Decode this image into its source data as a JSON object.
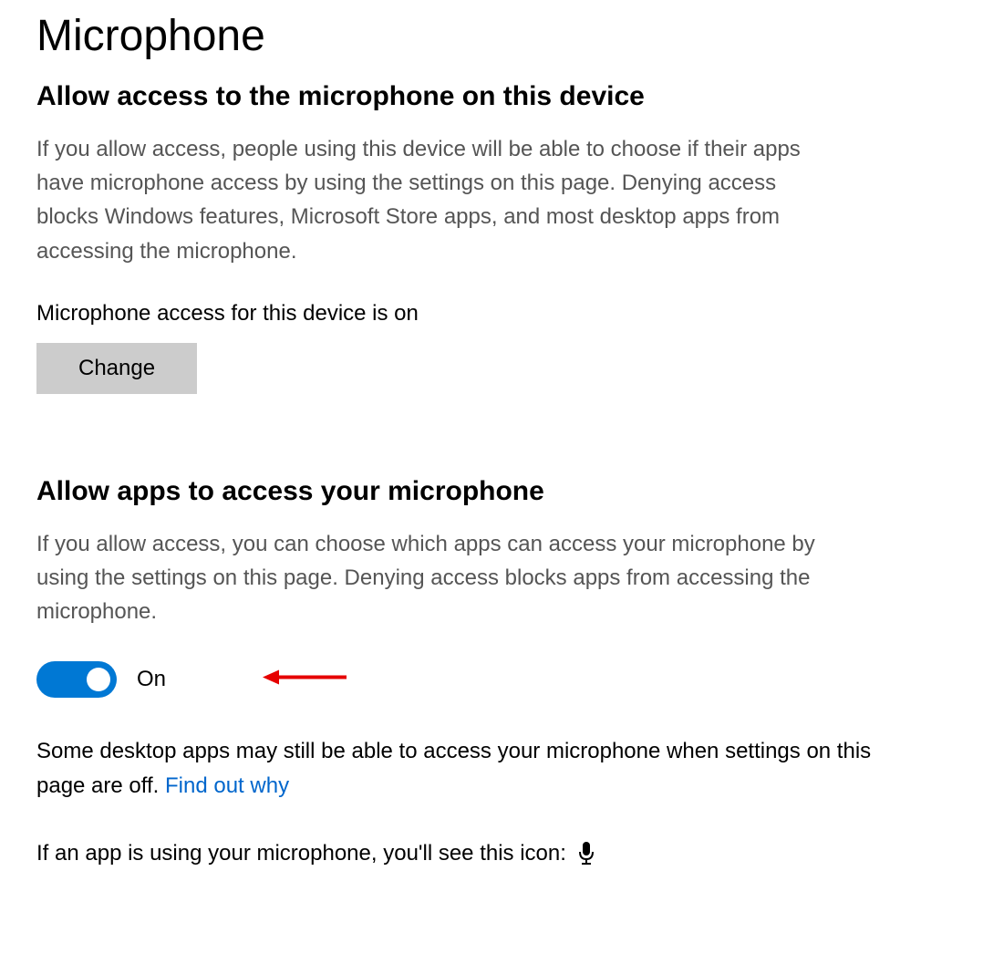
{
  "page": {
    "title": "Microphone"
  },
  "section1": {
    "heading": "Allow access to the microphone on this device",
    "description": "If you allow access, people using this device will be able to choose if their apps have microphone access by using the settings on this page. Denying access blocks Windows features, Microsoft Store apps, and most desktop apps from accessing the microphone.",
    "status": "Microphone access for this device is on",
    "change_button": "Change"
  },
  "section2": {
    "heading": "Allow apps to access your microphone",
    "description": "If you allow access, you can choose which apps can access your microphone by using the settings on this page. Denying access blocks apps from accessing the microphone.",
    "toggle_state": "On",
    "note_before": "Some desktop apps may still be able to access your microphone when settings on this page are off. ",
    "note_link": "Find out why",
    "icon_row_text": "If an app is using your microphone, you'll see this icon:"
  }
}
